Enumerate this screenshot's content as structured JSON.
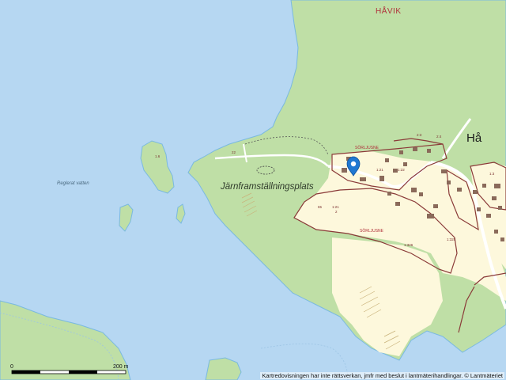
{
  "map": {
    "labels": {
      "havik": "HÅVIK",
      "ha": "Hå",
      "site": "Järnframställningsplats",
      "water": "Reglerat vatten",
      "sorljusne_1": "SÖRLJUSNE",
      "sorljusne_2": "SÖRLJUSNE",
      "island_number": "1.6",
      "plot_13": "1:3",
      "plot_121a": "1:21",
      "plot_122": "1:22",
      "plot_121b": "1:21",
      "plot_2": "2",
      "plot_1326": "1:326",
      "plot_1325": "1:325",
      "plot_23": "2:3",
      "plot_24": "2:4",
      "plot_65": "65",
      "plot_22": "22"
    },
    "scale_bar": {
      "start": "0",
      "end": "200 m"
    },
    "copyright": "Kartredovisningen har inte rättsverkan, jmfr med beslut i lantmäterihandlingar. © Lantmäteriet"
  },
  "colors": {
    "water": "#b6d7f2",
    "forest": "#bfdfa6",
    "open_land": "#fdf8dc",
    "property_line": "#8a3a38",
    "road": "#ffffff",
    "marker": "#1f78d1"
  },
  "marker": {
    "icon": "location-pin-icon"
  }
}
